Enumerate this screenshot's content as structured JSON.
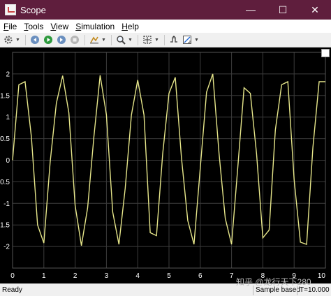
{
  "window": {
    "title": "Scope",
    "controls": {
      "minimize": "—",
      "maximize": "☐",
      "close": "✕"
    }
  },
  "menu": [
    {
      "label": "File",
      "mnemonic": "F",
      "rest": "ile"
    },
    {
      "label": "Tools",
      "mnemonic": "T",
      "rest": "ools"
    },
    {
      "label": "View",
      "mnemonic": "V",
      "rest": "iew"
    },
    {
      "label": "Simulation",
      "mnemonic": "S",
      "rest": "imulation"
    },
    {
      "label": "Help",
      "mnemonic": "H",
      "rest": "elp"
    }
  ],
  "toolbar": {
    "icons": [
      "settings-icon",
      "step-back-icon",
      "run-icon",
      "stop-icon",
      "highlight-icon",
      "zoom-icon",
      "autoscale-icon",
      "triggers-icon",
      "cursor-measurements-icon"
    ]
  },
  "status": {
    "left": "Ready",
    "mode": "Sample based",
    "time": "T=10.000"
  },
  "watermark": "知乎 @龙行天下280",
  "colors": {
    "titlebar": "#5f1e3d",
    "plot_bg": "#000000",
    "trace": "#e6e68a",
    "grid": "#3c3c3c",
    "tick_label": "#ffffff"
  },
  "chart_data": {
    "type": "line",
    "title": "",
    "xlabel": "",
    "ylabel": "",
    "xlim": [
      0,
      10
    ],
    "ylim": [
      -2.5,
      2.5
    ],
    "xticks": [
      "0",
      "1",
      "2",
      "3",
      "4",
      "5",
      "6",
      "7",
      "8",
      "9",
      "10"
    ],
    "yticks": [
      "2",
      "1.5",
      "1",
      "0.5",
      "0",
      "-0.5",
      "-1",
      "-1.5",
      "-2"
    ],
    "grid": true,
    "series": [
      {
        "x": [
          0,
          0.2,
          0.4,
          0.6,
          0.8,
          1.0,
          1.2,
          1.4,
          1.6,
          1.8,
          2.0,
          2.2,
          2.4,
          2.6,
          2.8,
          3.0,
          3.2,
          3.4,
          3.6,
          3.8,
          4.0,
          4.2,
          4.4,
          4.6,
          4.8,
          5.0,
          5.2,
          5.4,
          5.6,
          5.8,
          6.0,
          6.2,
          6.4,
          6.6,
          6.8,
          7.0,
          7.2,
          7.4,
          7.6,
          7.8,
          8.0,
          8.2,
          8.4,
          8.6,
          8.8,
          9.0,
          9.2,
          9.4,
          9.6,
          9.8,
          10.0
        ],
        "values": [
          0,
          1.75,
          1.82,
          0.55,
          -1.5,
          -1.92,
          -0.05,
          1.32,
          1.96,
          1.1,
          -1.05,
          -1.98,
          -1.1,
          0.55,
          1.97,
          1.05,
          -1.2,
          -1.95,
          -0.65,
          1.05,
          1.86,
          1.05,
          -1.68,
          -1.75,
          0.15,
          1.55,
          1.92,
          0.05,
          -1.4,
          -1.95,
          -0.18,
          1.58,
          2.0,
          0.15,
          -1.35,
          -1.95,
          -0.15,
          1.68,
          1.55,
          0.15,
          -1.8,
          -1.62,
          0.7,
          1.75,
          1.82,
          -0.45,
          -1.9,
          -1.95,
          0.3,
          1.82,
          1.82
        ]
      }
    ]
  }
}
